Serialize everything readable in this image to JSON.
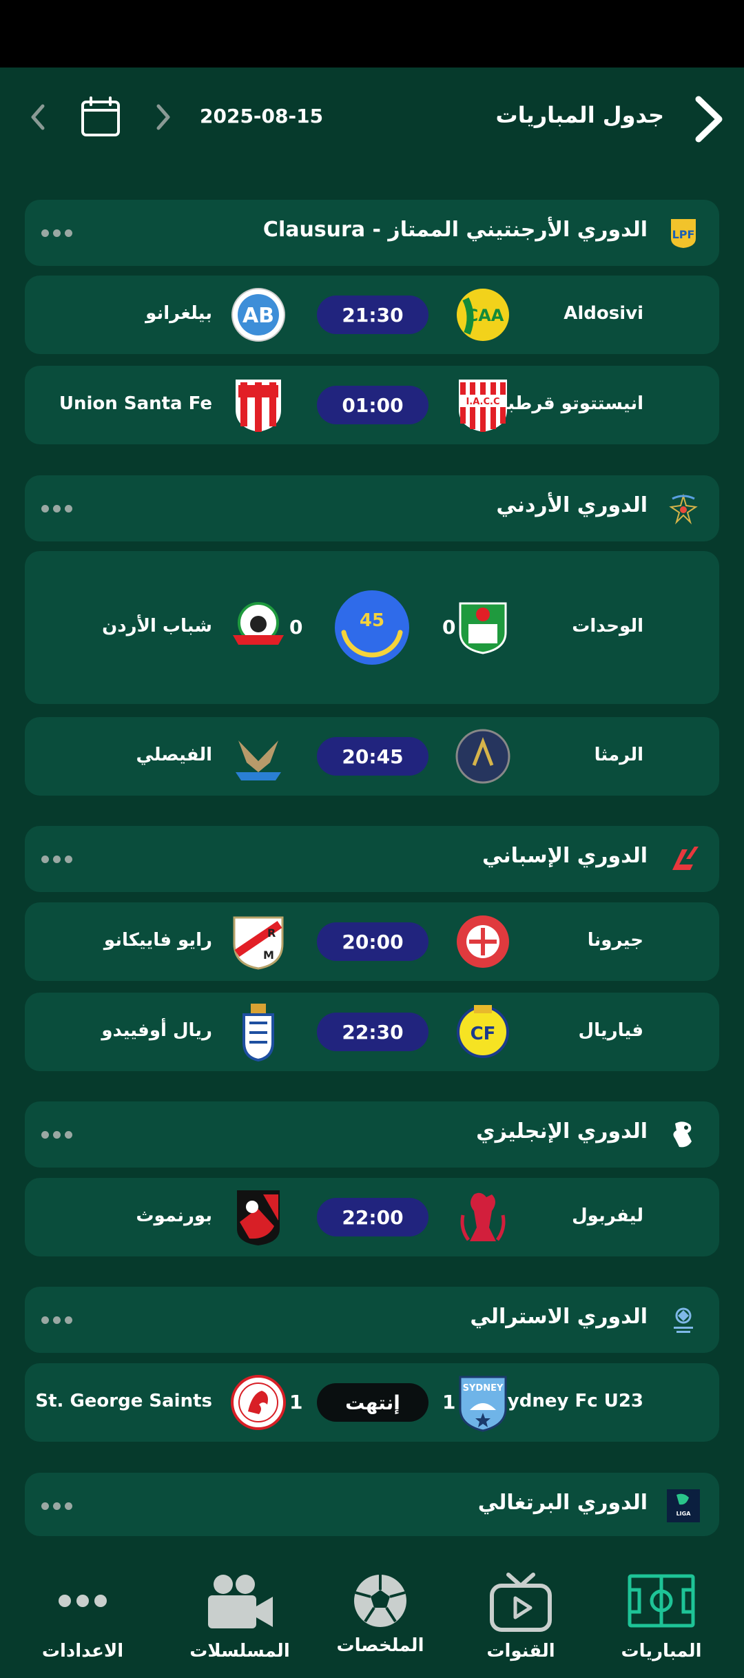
{
  "header": {
    "title": "جدول المباريات",
    "date": "2025-08-15"
  },
  "leagues": [
    {
      "name": "الدوري الأرجنتيني الممتاز - Clausura",
      "logo": "lpf-logo",
      "matches": [
        {
          "home": "Aldosivi",
          "away": "بيلغرانو",
          "time": "21:30"
        },
        {
          "home": "انيستتوتو قرطبة",
          "away": "Union Santa Fe",
          "time": "01:00"
        }
      ]
    },
    {
      "name": "الدوري الأردني",
      "logo": "jordan-league-logo",
      "matches": [
        {
          "home": "الوحدات",
          "away": "شباب الأردن",
          "home_score": "0",
          "away_score": "0",
          "minute": "45",
          "live": true
        },
        {
          "home": "الرمثا",
          "away": "الفيصلي",
          "time": "20:45"
        }
      ]
    },
    {
      "name": "الدوري الإسباني",
      "logo": "laliga-logo",
      "matches": [
        {
          "home": "جيرونا",
          "away": "رايو فاييكانو",
          "time": "20:00"
        },
        {
          "home": "فياريال",
          "away": "ريال أوفييدو",
          "time": "22:30"
        }
      ]
    },
    {
      "name": "الدوري الإنجليزي",
      "logo": "premier-league-logo",
      "matches": [
        {
          "home": "ليفربول",
          "away": "بورنموث",
          "time": "22:00"
        }
      ]
    },
    {
      "name": "الدوري الاسترالي",
      "logo": "australian-npl-logo",
      "matches": [
        {
          "home": "Sydney Fc U23",
          "away": "St. George Saints",
          "home_score": "1",
          "away_score": "1",
          "status": "إنتهت"
        }
      ]
    },
    {
      "name": "الدوري البرتغالي",
      "logo": "liga-portugal-logo",
      "matches": []
    }
  ],
  "nav": [
    {
      "label": "المباريات",
      "icon": "pitch-icon",
      "active": true
    },
    {
      "label": "القنوات",
      "icon": "tv-icon"
    },
    {
      "label": "الملخصات",
      "icon": "football-icon"
    },
    {
      "label": "المسلسلات",
      "icon": "video-camera-icon"
    },
    {
      "label": "الاعدادات",
      "icon": "more-dots-icon"
    }
  ],
  "colors": {
    "background": "#063a2c",
    "card": "#0a4d3c",
    "time_pill": "#21247e",
    "ended_pill": "#0a0f10",
    "live_circle": "#2f6bea",
    "live_minute": "#f5d33b",
    "active_nav": "#1ec497"
  }
}
